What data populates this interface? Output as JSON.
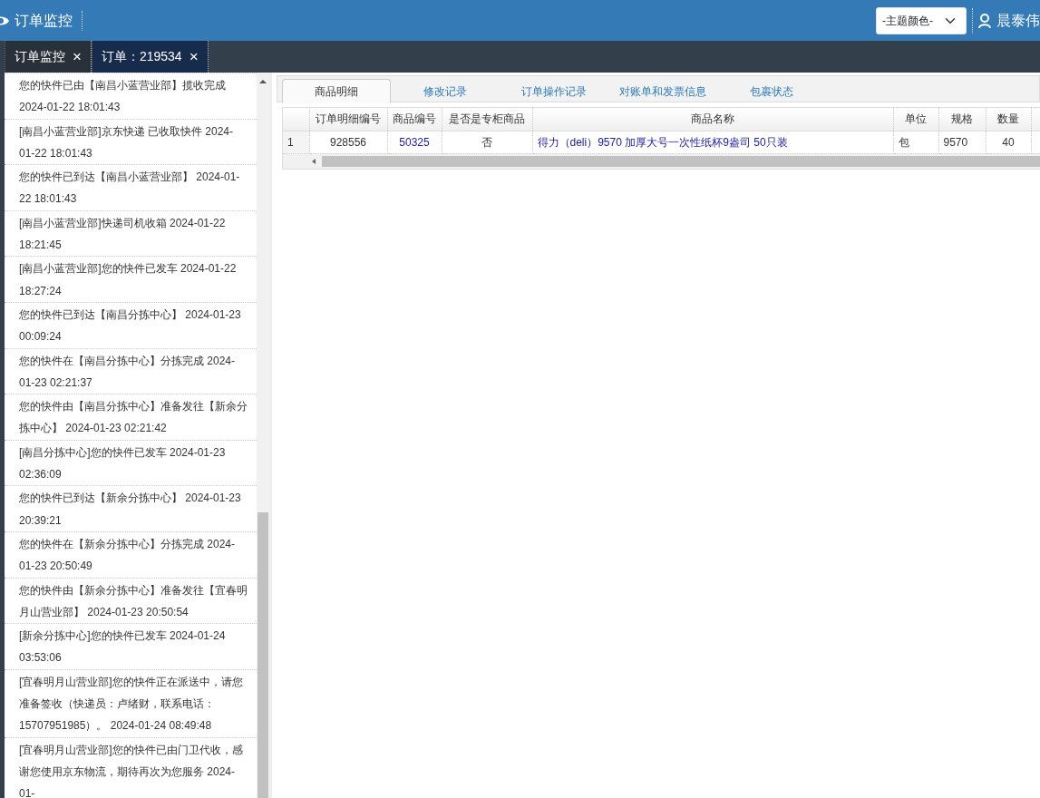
{
  "header": {
    "title": "订单监控",
    "theme_select": {
      "value": "-主题颜色-"
    },
    "user_name": "晨泰伟"
  },
  "page_tabs": [
    {
      "label": "订单监控",
      "close": "×",
      "selected": false
    },
    {
      "label": "订单：219534",
      "close": "×",
      "selected": true
    }
  ],
  "tracking_log": [
    "您的快件已由【南昌小蓝营业部】揽收完成 2024-01-22 18:01:43",
    "[南昌小蓝营业部]京东快递 已收取快件 2024-01-22 18:01:43",
    "您的快件已到达【南昌小蓝营业部】 2024-01-22 18:01:43",
    "[南昌小蓝营业部]快递司机收箱 2024-01-22 18:21:45",
    "[南昌小蓝营业部]您的快件已发车 2024-01-22 18:27:24",
    "您的快件已到达【南昌分拣中心】 2024-01-23 00:09:24",
    "您的快件在【南昌分拣中心】分拣完成 2024-01-23 02:21:37",
    "您的快件由【南昌分拣中心】准备发往【新余分拣中心】 2024-01-23 02:21:42",
    "[南昌分拣中心]您的快件已发车 2024-01-23 02:36:09",
    "您的快件已到达【新余分拣中心】 2024-01-23 20:39:21",
    "您的快件在【新余分拣中心】分拣完成 2024-01-23 20:50:49",
    "您的快件由【新余分拣中心】准备发往【宜春明月山营业部】 2024-01-23 20:50:54",
    "[新余分拣中心]您的快件已发车 2024-01-24 03:53:06",
    "[宜春明月山营业部]您的快件正在派送中，请您准备签收（快递员：卢绪财，联系电话：15707951985）。 2024-01-24 08:49:48",
    "[宜春明月山营业部]您的快件已由门卫代收，感谢您使用京东物流，期待再次为您服务 2024-01-"
  ],
  "detail_tabs": [
    {
      "label": "商品明细",
      "selected": true
    },
    {
      "label": "修改记录",
      "selected": false
    },
    {
      "label": "订单操作记录",
      "selected": false
    },
    {
      "label": "对账单和发票信息",
      "selected": false
    },
    {
      "label": "包裹状态",
      "selected": false
    }
  ],
  "table": {
    "columns": [
      "订单明细编号",
      "商品编号",
      "是否是专柜商品",
      "商品名称",
      "单位",
      "规格",
      "数量"
    ],
    "rows": [
      {
        "row_number": "1",
        "cells": [
          "928556",
          "50325",
          "否",
          "得力（deli）9570 加厚大号一次性纸杯9盎司 50只装",
          "包",
          "9570",
          "40"
        ]
      }
    ]
  }
}
